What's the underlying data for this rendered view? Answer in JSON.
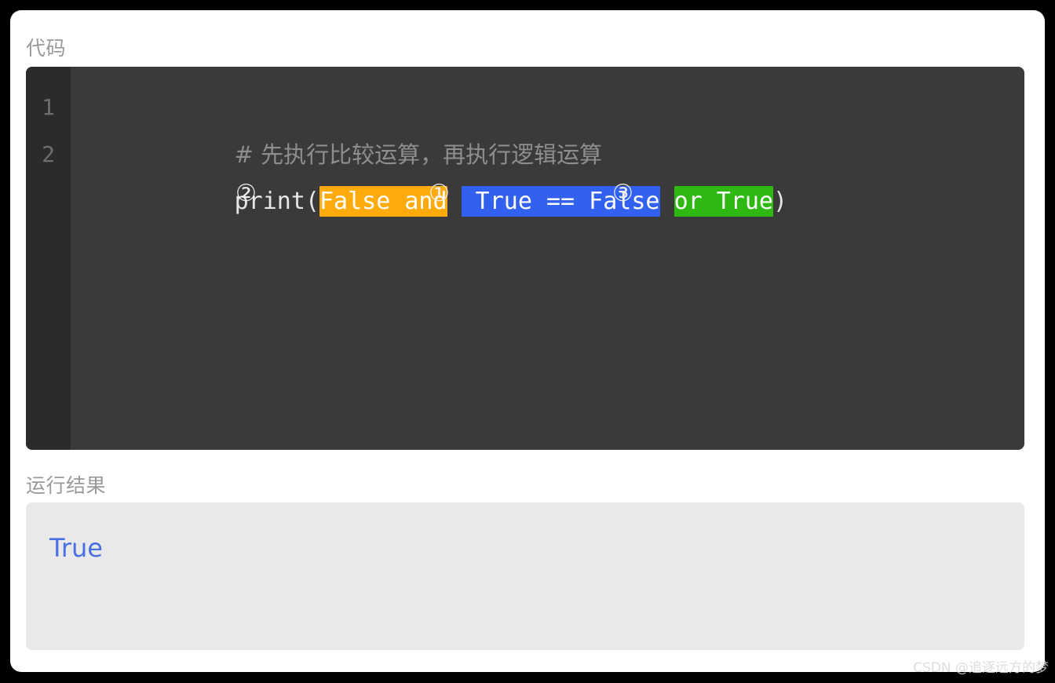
{
  "page": {
    "background_color": "#000000",
    "card_color": "#ffffff"
  },
  "code_section": {
    "label": "代码",
    "gutter": {
      "line_numbers": [
        "1",
        "2"
      ]
    },
    "lines": [
      {
        "number": "1",
        "type": "comment",
        "text": "# 先执行比较运算，再执行逻辑运算"
      },
      {
        "number": "2",
        "type": "statement",
        "prefix": "print(",
        "segments": [
          {
            "text": "False and",
            "highlight": "orange",
            "color": "#ffaa0d",
            "marker": "②"
          },
          {
            "text": " True == False",
            "highlight": "blue",
            "color": "#3161ee",
            "marker": "①"
          },
          {
            "text": "or True",
            "highlight": "green",
            "color": "#2eb812",
            "marker": "③"
          }
        ],
        "suffix": ")",
        "gap1": " ",
        "gap2": " "
      }
    ],
    "markers": {
      "orange": "②",
      "blue": "①",
      "green": "③"
    },
    "colors": {
      "block_bg": "#3a3a3a",
      "gutter_bg": "#2b2b2b",
      "line_number": "#6e6e6e",
      "comment": "#8e8e8e",
      "code_text": "#e6e6e6",
      "highlight_orange": "#ffaa0d",
      "highlight_blue": "#3161ee",
      "highlight_green": "#2eb812"
    }
  },
  "output_section": {
    "label": "运行结果",
    "value": "True",
    "colors": {
      "box_bg": "#e9e9e9",
      "text": "#4a6fe0"
    }
  },
  "watermark": {
    "text": "CSDN @追逐远方的梦"
  }
}
